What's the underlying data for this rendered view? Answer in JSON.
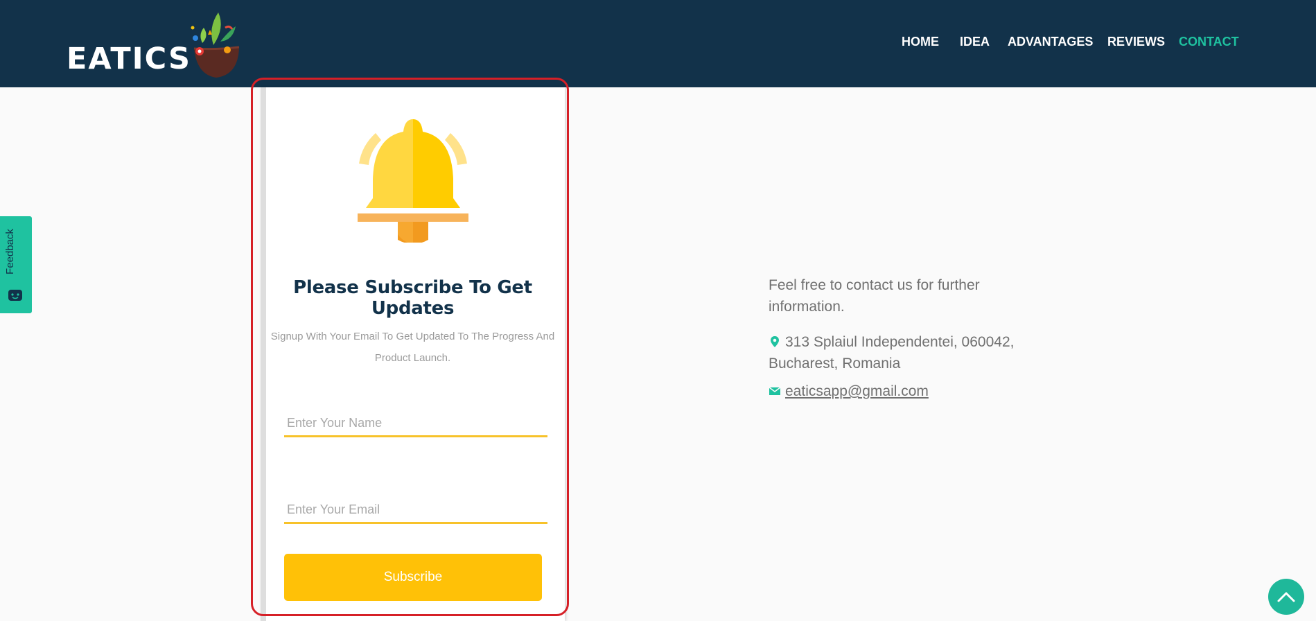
{
  "header": {
    "logo_text": "EATICS",
    "nav": [
      {
        "label": "HOME",
        "active": false
      },
      {
        "label": "IDEA",
        "active": false
      },
      {
        "label": "ADVANTAGES",
        "active": false
      },
      {
        "label": "REVIEWS",
        "active": false
      },
      {
        "label": "CONTACT",
        "active": true
      }
    ]
  },
  "feedback": {
    "label": "Feedback",
    "icon": "feedback-face-icon"
  },
  "subscribe_card": {
    "icon": "bell-icon",
    "title": "Please Subscribe To Get Updates",
    "subtitle": "Signup With Your Email To Get Updated To The Progress And Product Launch.",
    "name_placeholder": "Enter Your Name",
    "email_placeholder": "Enter Your Email",
    "button_label": "Subscribe"
  },
  "contact": {
    "intro": "Feel free to contact us for further information.",
    "address": "313 Splaiul Independentei, 060042, Bucharest, Romania",
    "address_icon": "map-pin-icon",
    "email": "eaticsapp@gmail.com",
    "email_icon": "envelope-icon"
  },
  "scroll_top": {
    "icon": "chevron-up-icon"
  },
  "colors": {
    "header_bg": "#12324a",
    "accent": "#1fc2a0",
    "button": "#ffc107",
    "field_underline": "#f7c22a",
    "highlight_border": "#d62027"
  }
}
